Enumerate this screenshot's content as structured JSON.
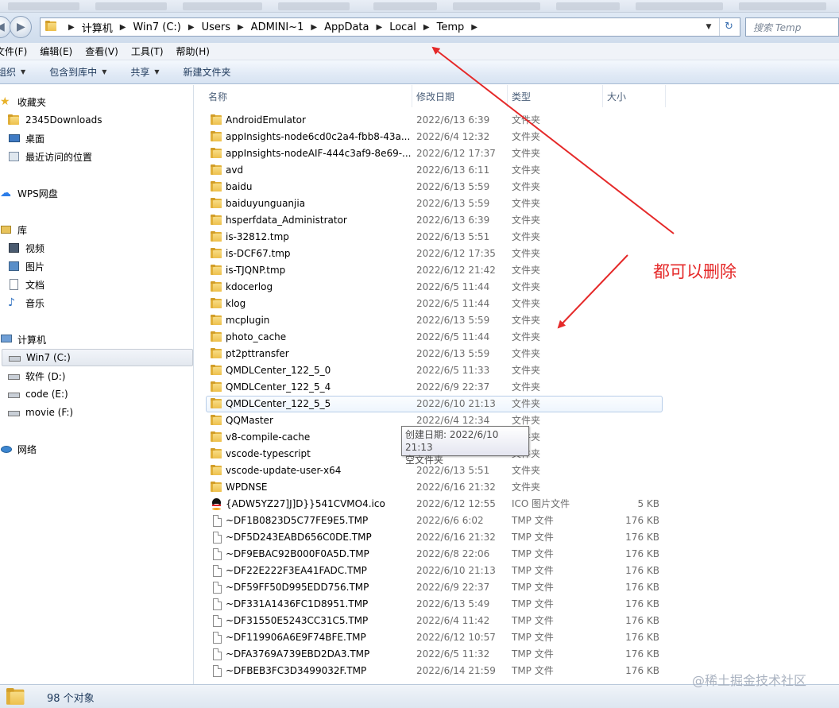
{
  "window": {
    "breadcrumbs": [
      "计算机",
      "Win7 (C:)",
      "Users",
      "ADMINI~1",
      "AppData",
      "Local",
      "Temp"
    ],
    "search_placeholder": "搜索 Temp"
  },
  "menu": {
    "file": "文件(F)",
    "edit": "编辑(E)",
    "view": "查看(V)",
    "tools": "工具(T)",
    "help": "帮助(H)"
  },
  "toolbar": {
    "organize": "组织",
    "include_in_library": "包含到库中",
    "share": "共享",
    "new_folder": "新建文件夹"
  },
  "nav": {
    "favorites": "收藏夹",
    "downloads": "2345Downloads",
    "desktop": "桌面",
    "recent": "最近访问的位置",
    "wps": "WPS网盘",
    "libraries": "库",
    "videos": "视频",
    "pictures": "图片",
    "documents": "文档",
    "music": "音乐",
    "computer": "计算机",
    "drive_c": "Win7 (C:)",
    "drive_d": "软件 (D:)",
    "drive_e": "code (E:)",
    "drive_f": "movie (F:)",
    "network": "网络"
  },
  "columns": {
    "name": "名称",
    "date": "修改日期",
    "type": "类型",
    "size": "大小"
  },
  "files": [
    {
      "name": "AndroidEmulator",
      "date": "2022/6/13 6:39",
      "type": "文件夹",
      "size": "",
      "icon": "folder-icon"
    },
    {
      "name": "appInsights-node6cd0c2a4-fbb8-43a...",
      "date": "2022/6/4 12:32",
      "type": "文件夹",
      "size": "",
      "icon": "folder-icon"
    },
    {
      "name": "appInsights-nodeAIF-444c3af9-8e69-...",
      "date": "2022/6/12 17:37",
      "type": "文件夹",
      "size": "",
      "icon": "folder-icon"
    },
    {
      "name": "avd",
      "date": "2022/6/13 6:11",
      "type": "文件夹",
      "size": "",
      "icon": "folder-icon"
    },
    {
      "name": "baidu",
      "date": "2022/6/13 5:59",
      "type": "文件夹",
      "size": "",
      "icon": "folder-icon"
    },
    {
      "name": "baiduyunguanjia",
      "date": "2022/6/13 5:59",
      "type": "文件夹",
      "size": "",
      "icon": "folder-icon"
    },
    {
      "name": "hsperfdata_Administrator",
      "date": "2022/6/13 6:39",
      "type": "文件夹",
      "size": "",
      "icon": "folder-icon"
    },
    {
      "name": "is-32812.tmp",
      "date": "2022/6/13 5:51",
      "type": "文件夹",
      "size": "",
      "icon": "folder-icon"
    },
    {
      "name": "is-DCF67.tmp",
      "date": "2022/6/12 17:35",
      "type": "文件夹",
      "size": "",
      "icon": "folder-icon"
    },
    {
      "name": "is-TJQNP.tmp",
      "date": "2022/6/12 21:42",
      "type": "文件夹",
      "size": "",
      "icon": "folder-icon"
    },
    {
      "name": "kdocerlog",
      "date": "2022/6/5 11:44",
      "type": "文件夹",
      "size": "",
      "icon": "folder-icon"
    },
    {
      "name": "klog",
      "date": "2022/6/5 11:44",
      "type": "文件夹",
      "size": "",
      "icon": "folder-icon"
    },
    {
      "name": "mcplugin",
      "date": "2022/6/13 5:59",
      "type": "文件夹",
      "size": "",
      "icon": "folder-icon"
    },
    {
      "name": "photo_cache",
      "date": "2022/6/5 11:44",
      "type": "文件夹",
      "size": "",
      "icon": "folder-icon"
    },
    {
      "name": "pt2pttransfer",
      "date": "2022/6/13 5:59",
      "type": "文件夹",
      "size": "",
      "icon": "folder-icon"
    },
    {
      "name": "QMDLCenter_122_5_0",
      "date": "2022/6/5 11:33",
      "type": "文件夹",
      "size": "",
      "icon": "folder-icon"
    },
    {
      "name": "QMDLCenter_122_5_4",
      "date": "2022/6/9 22:37",
      "type": "文件夹",
      "size": "",
      "icon": "folder-icon"
    },
    {
      "name": "QMDLCenter_122_5_5",
      "date": "2022/6/10 21:13",
      "type": "文件夹",
      "size": "",
      "icon": "folder-icon",
      "selected": true
    },
    {
      "name": "QQMaster",
      "date": "2022/6/4 12:34",
      "type": "文件夹",
      "size": "",
      "icon": "folder-icon"
    },
    {
      "name": "v8-compile-cache",
      "date": "",
      "type": "文件夹",
      "size": "",
      "icon": "folder-icon"
    },
    {
      "name": "vscode-typescript",
      "date": "",
      "type": "文件夹",
      "size": "",
      "icon": "folder-icon"
    },
    {
      "name": "vscode-update-user-x64",
      "date": "2022/6/13 5:51",
      "type": "文件夹",
      "size": "",
      "icon": "folder-icon"
    },
    {
      "name": "WPDNSE",
      "date": "2022/6/16 21:32",
      "type": "文件夹",
      "size": "",
      "icon": "folder-icon"
    },
    {
      "name": "{ADW5YZ27]J]D}}541CVMO4.ico",
      "date": "2022/6/12 12:55",
      "type": "ICO 图片文件",
      "size": "5 KB",
      "icon": "qq-icon"
    },
    {
      "name": "~DF1B0823D5C77FE9E5.TMP",
      "date": "2022/6/6 6:02",
      "type": "TMP 文件",
      "size": "176 KB",
      "icon": "file-icon"
    },
    {
      "name": "~DF5D243EABD656C0DE.TMP",
      "date": "2022/6/16 21:32",
      "type": "TMP 文件",
      "size": "176 KB",
      "icon": "file-icon"
    },
    {
      "name": "~DF9EBAC92B000F0A5D.TMP",
      "date": "2022/6/8 22:06",
      "type": "TMP 文件",
      "size": "176 KB",
      "icon": "file-icon"
    },
    {
      "name": "~DF22E222F3EA41FADC.TMP",
      "date": "2022/6/10 21:13",
      "type": "TMP 文件",
      "size": "176 KB",
      "icon": "file-icon"
    },
    {
      "name": "~DF59FF50D995EDD756.TMP",
      "date": "2022/6/9 22:37",
      "type": "TMP 文件",
      "size": "176 KB",
      "icon": "file-icon"
    },
    {
      "name": "~DF331A1436FC1D8951.TMP",
      "date": "2022/6/13 5:49",
      "type": "TMP 文件",
      "size": "176 KB",
      "icon": "file-icon"
    },
    {
      "name": "~DF31550E5243CC31C5.TMP",
      "date": "2022/6/4 11:42",
      "type": "TMP 文件",
      "size": "176 KB",
      "icon": "file-icon"
    },
    {
      "name": "~DF119906A6E9F74BFE.TMP",
      "date": "2022/6/12 10:57",
      "type": "TMP 文件",
      "size": "176 KB",
      "icon": "file-icon"
    },
    {
      "name": "~DFA3769A739EBD2DA3.TMP",
      "date": "2022/6/5 11:32",
      "type": "TMP 文件",
      "size": "176 KB",
      "icon": "file-icon"
    },
    {
      "name": "~DFBEB3FC3D3499032F.TMP",
      "date": "2022/6/14 21:59",
      "type": "TMP 文件",
      "size": "176 KB",
      "icon": "file-icon"
    }
  ],
  "tooltip": {
    "line1": "创建日期: 2022/6/10 21:13",
    "line2": "空文件夹"
  },
  "annotation": {
    "text": "都可以删除",
    "color": "#e52929"
  },
  "status": {
    "count": "98 个对象"
  },
  "watermark": "@稀土掘金技术社区"
}
